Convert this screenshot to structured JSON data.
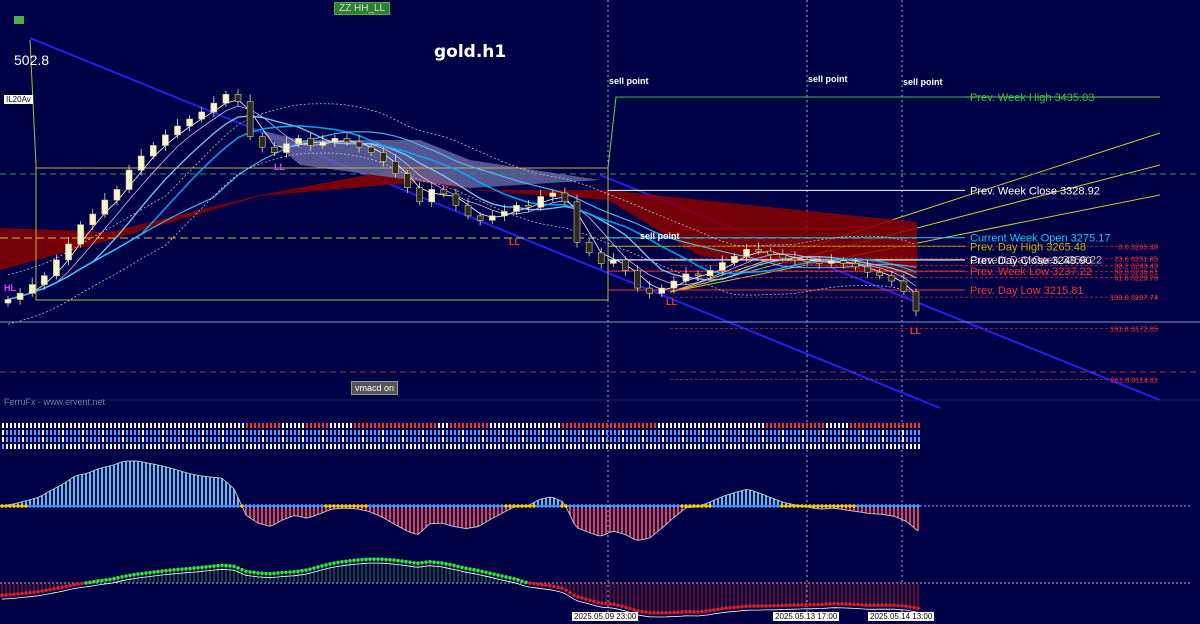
{
  "chart_data": {
    "type": "candlestick",
    "title": "gold.h1",
    "top_left_value": "502.8",
    "indicator_tag": "IL20Av",
    "top_badge": "ZZ HH_LL",
    "watermark": "FerruFx - www.ervent.net",
    "button_label": "vmacd on",
    "price_axis_range": [
      3100,
      3470
    ],
    "sell_point_label": "sell point",
    "sell_points": [
      {
        "label": "sell point",
        "time": "2025.05.09 23:00"
      },
      {
        "label": "sell point",
        "time": "2025.05.13 17:00"
      },
      {
        "label": "sell point",
        "time": "2025.05.14 13:00"
      }
    ],
    "mid_sell_point": "sell point",
    "swing_labels": [
      "HL",
      "LL",
      "LL",
      "LL",
      "LL",
      "LL"
    ],
    "levels": [
      {
        "label": "Prev. Week High 3435.03",
        "price": 3435.03,
        "color": "#37c837"
      },
      {
        "label": "Prev. Week Close 3328.92",
        "price": 3328.92,
        "color": "#ffffff"
      },
      {
        "label": "Current Week Open 3275.17",
        "price": 3275.17,
        "color": "#00cfff"
      },
      {
        "label": "Prev. Day High 3265.48",
        "price": 3265.48,
        "color": "#bfbf00"
      },
      {
        "label": "Current Day Open 3250.22",
        "price": 3250.22,
        "color": "#bbbbbb"
      },
      {
        "label": "Prev. Day Close 3249.90",
        "price": 3249.9,
        "color": "#ffffff"
      },
      {
        "label": "Prev. Week Low 3237.22",
        "price": 3237.22,
        "color": "#ff3030"
      },
      {
        "label": "Prev. Day Low 3215.81",
        "price": 3215.81,
        "color": "#ff3030"
      }
    ],
    "fib_levels": [
      {
        "label": "0.0  3265.48",
        "price": 3265.48
      },
      {
        "label": "23.6  3251.85",
        "price": 3251.85
      },
      {
        "label": "38.2  3243.43",
        "price": 3243.43
      },
      {
        "label": "50.0  3236.61",
        "price": 3236.61
      },
      {
        "label": "61.8  3229.79",
        "price": 3229.79
      },
      {
        "label": "100.0  3207.74",
        "price": 3207.74
      },
      {
        "label": "161.8  3172.05",
        "price": 3172.05
      },
      {
        "label": "261.8  3114.31",
        "price": 3114.31
      }
    ],
    "time_labels": [
      "2025.05.09 23:00",
      "2025.05.13 17:00",
      "2025.05.14 13:00"
    ],
    "close_series": [
      3205,
      3212,
      3222,
      3232,
      3250,
      3268,
      3290,
      3302,
      3318,
      3330,
      3352,
      3368,
      3380,
      3392,
      3402,
      3410,
      3418,
      3428,
      3438,
      3430,
      3390,
      3378,
      3372,
      3382,
      3388,
      3380,
      3384,
      3388,
      3384,
      3378,
      3372,
      3362,
      3348,
      3332,
      3316,
      3330,
      3325,
      3312,
      3300,
      3295,
      3300,
      3305,
      3312,
      3310,
      3322,
      3326,
      3316,
      3270,
      3258,
      3246,
      3250,
      3238,
      3218,
      3212,
      3218,
      3226,
      3234,
      3232,
      3238,
      3247,
      3254,
      3262,
      3260,
      3256,
      3252,
      3250,
      3248,
      3246,
      3249,
      3246,
      3242,
      3236,
      3232,
      3226,
      3214,
      3192
    ]
  }
}
